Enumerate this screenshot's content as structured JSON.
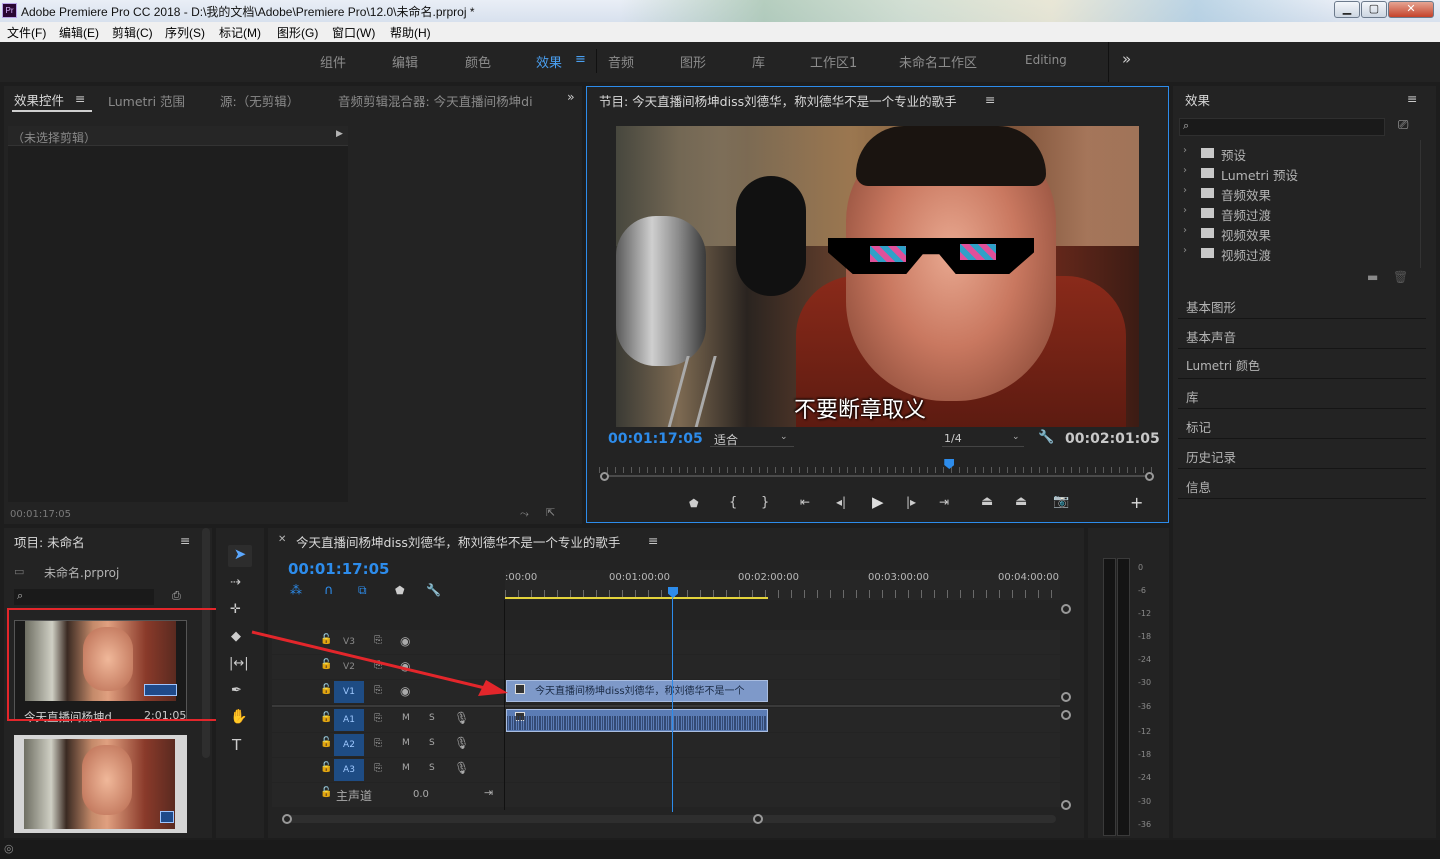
{
  "window": {
    "title": "Adobe Premiere Pro CC 2018 - D:\\我的文档\\Adobe\\Premiere Pro\\12.0\\未命名.prproj *",
    "app_icon": "Pr"
  },
  "menu": [
    "文件(F)",
    "编辑(E)",
    "剪辑(C)",
    "序列(S)",
    "标记(M)",
    "图形(G)",
    "窗口(W)",
    "帮助(H)"
  ],
  "workspaces": {
    "items": [
      "组件",
      "编辑",
      "颜色",
      "效果",
      "音频",
      "图形",
      "库",
      "工作区1",
      "未命名工作区",
      "Editing"
    ],
    "active": "效果",
    "more": "»"
  },
  "source_panel": {
    "tabs": [
      "效果控件",
      "Lumetri 范围",
      "源:（无剪辑）",
      "音频剪辑混合器: 今天直播间杨坤di"
    ],
    "no_clip": "（未选择剪辑）",
    "timecode": "00:01:17:05"
  },
  "program": {
    "title": "节目: 今天直播间杨坤diss刘德华，称刘德华不是一个专业的歌手",
    "subtitle": "不要断章取义",
    "timecode": "00:01:17:05",
    "fit": "适合",
    "resolution": "1/4",
    "duration": "00:02:01:05",
    "playhead_fraction": 0.63
  },
  "project": {
    "title": "项目: 未命名",
    "file": "未命名.prproj",
    "items": [
      {
        "name": "今天直播间杨坤d...",
        "duration": "2:01:05"
      }
    ]
  },
  "timeline": {
    "title": "今天直播间杨坤diss刘德华，称刘德华不是一个专业的歌手",
    "timecode": "00:01:17:05",
    "ruler": [
      ":00:00",
      "00:01:00:00",
      "00:02:00:00",
      "00:03:00:00",
      "00:04:00:00"
    ],
    "video_tracks": [
      "V3",
      "V2",
      "V1"
    ],
    "audio_tracks": [
      "A1",
      "A2",
      "A3"
    ],
    "master": "主声道",
    "master_value": "0.0",
    "clip_label": "今天直播间杨坤diss刘德华，称刘德华不是一个",
    "track_buttons": {
      "mute": "M",
      "solo": "S"
    }
  },
  "effects": {
    "title": "效果",
    "folders": [
      "预设",
      "Lumetri 预设",
      "音频效果",
      "音频过渡",
      "视频效果",
      "视频过渡"
    ],
    "panels": [
      "基本图形",
      "基本声音",
      "Lumetri 颜色",
      "库",
      "标记",
      "历史记录",
      "信息"
    ]
  },
  "meter": {
    "scale": [
      "0",
      "-6",
      "-12",
      "-18",
      "-24",
      "-30",
      "-36",
      "-12",
      "-18",
      "-24",
      "-30",
      "-36"
    ]
  },
  "colors": {
    "accent": "#2d8ceb",
    "clip_video": "#7e99c9",
    "annotation": "#e3262b",
    "work_area": "#e3d33b"
  }
}
